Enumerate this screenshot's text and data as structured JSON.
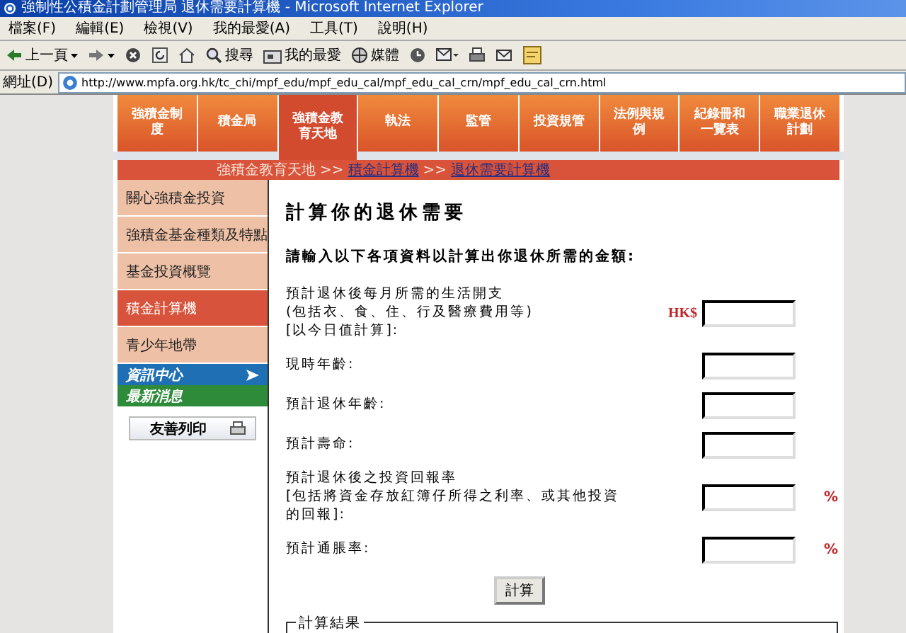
{
  "window": {
    "title": "強制性公積金計劃管理局 退休需要計算機 - Microsoft Internet Explorer"
  },
  "menu_bar": [
    "檔案(F)",
    "編輯(E)",
    "檢視(V)",
    "我的最愛(A)",
    "工具(T)",
    "說明(H)"
  ],
  "toolbar": [
    {
      "kind": "back",
      "label": "上一頁"
    },
    {
      "kind": "forward"
    },
    {
      "kind": "stop"
    },
    {
      "kind": "refresh"
    },
    {
      "kind": "home"
    },
    {
      "kind": "search",
      "label": "搜尋"
    },
    {
      "kind": "favorites",
      "label": "我的最愛"
    },
    {
      "kind": "media",
      "label": "媒體"
    },
    {
      "kind": "history"
    },
    {
      "kind": "mail"
    },
    {
      "kind": "print"
    },
    {
      "kind": "edit"
    },
    {
      "kind": "discuss"
    }
  ],
  "address_bar": {
    "label": "網址(D)",
    "url": "http://www.mpfa.org.hk/tc_chi/mpf_edu/mpf_edu_cal/mpf_edu_cal_crn/mpf_edu_cal_crn.html"
  },
  "nav_tabs": [
    {
      "label": "強積金制度",
      "selected": false
    },
    {
      "label": "積金局",
      "selected": false
    },
    {
      "label": "強積金教育天地",
      "selected": true
    },
    {
      "label": "執法",
      "selected": false
    },
    {
      "label": "監管",
      "selected": false
    },
    {
      "label": "投資規管",
      "selected": false
    },
    {
      "label": "法例與規例",
      "selected": false
    },
    {
      "label": "紀錄冊和一覽表",
      "selected": false
    },
    {
      "label": "職業退休計劃",
      "selected": false
    }
  ],
  "breadcrumb": [
    {
      "kind": "text",
      "text": "強積金教育天地"
    },
    {
      "kind": "separator",
      "text": ">>"
    },
    {
      "kind": "link",
      "text": "積金計算機"
    },
    {
      "kind": "separator",
      "text": ">>"
    },
    {
      "kind": "link",
      "text": "退休需要計算機"
    }
  ],
  "sidebar": {
    "items": [
      {
        "label": "關心強積金投資",
        "selected": false
      },
      {
        "label": "強積金基金種類及特點",
        "selected": false
      },
      {
        "label": "基金投資概覽",
        "selected": false
      },
      {
        "label": "積金計算機",
        "selected": true
      },
      {
        "label": "青少年地帶",
        "selected": false
      }
    ],
    "sections": [
      {
        "label": "資訊中心",
        "color": "#1f6fb4",
        "arrow": true
      },
      {
        "label": "最新消息",
        "color": "#2e8b3a",
        "arrow": false
      }
    ],
    "print_button": "友善列印"
  },
  "main": {
    "title": "計算你的退休需要",
    "instruction": "請輸入以下各項資料以計算出你退休所需的金額:",
    "fields": [
      {
        "label": "預計退休後每月所需的生活開支\n(包括衣、食、住、行及醫療費用等)\n[以今日值計算]:",
        "prefix": "HK$"
      },
      {
        "label": "現時年齡:"
      },
      {
        "label": "預計退休年齡:"
      },
      {
        "label": "預計壽命:"
      },
      {
        "label": "預計退休後之投資回報率\n[包括將資金存放紅簿仔所得之利率、或其他投資的回報]:",
        "suffix": "%"
      },
      {
        "label": "預計通脹率:",
        "suffix": "%"
      }
    ],
    "button": "計算",
    "result_legend": "計算結果"
  }
}
